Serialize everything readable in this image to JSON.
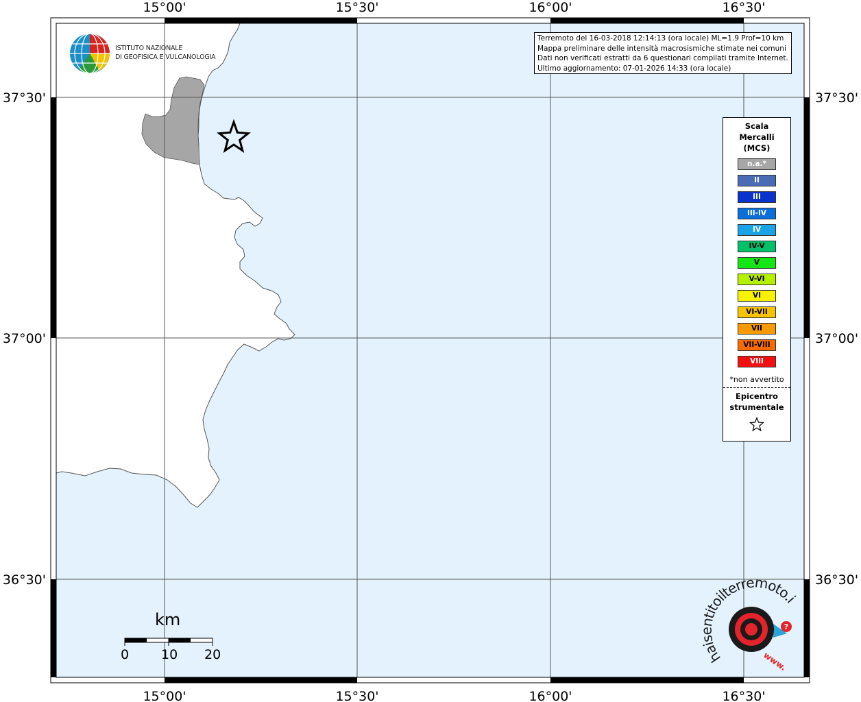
{
  "map": {
    "axis_labels": {
      "top": [
        "15°00'",
        "15°30'",
        "16°00'",
        "16°30'"
      ],
      "bottom": [
        "15°00'",
        "15°30'",
        "16°00'",
        "16°30'"
      ],
      "left": [
        "37°30'",
        "37°00'",
        "36°30'"
      ],
      "right": [
        "37°30'",
        "37°00'",
        "36°30'"
      ]
    },
    "sea_color": "#e3f2fc",
    "land_color": "#ffffff",
    "affected_color": "#a6a6a6"
  },
  "info": {
    "line1": "Terremoto del 16-03-2018 12:14:13 (ora locale) ML=1.9 Prof=10 km",
    "line2": "Mappa preliminare delle intensità macrosismiche stimate nei comuni",
    "line3": "Dati non verificati estratti da 6 questionari compilati tramite Internet.",
    "line4": "Ultimo aggiornamento: 07-01-2026 14:33 (ora locale)"
  },
  "legend": {
    "title_line1": "Scala",
    "title_line2": "Mercalli",
    "title_line3": "(MCS)",
    "items": [
      {
        "label": "n.a.*",
        "color": "#a6a6a6",
        "text": "#ffffff"
      },
      {
        "label": "II",
        "color": "#4a6bb5",
        "text": "#ffffff"
      },
      {
        "label": "III",
        "color": "#0a33cc",
        "text": "#ffffff"
      },
      {
        "label": "III-IV",
        "color": "#0a6fd8",
        "text": "#ffffff"
      },
      {
        "label": "IV",
        "color": "#1aa3e6",
        "text": "#ffffff"
      },
      {
        "label": "IV-V",
        "color": "#00c06a",
        "text": "#000000"
      },
      {
        "label": "V",
        "color": "#14e614",
        "text": "#000000"
      },
      {
        "label": "V-VI",
        "color": "#b4f000",
        "text": "#000000"
      },
      {
        "label": "VI",
        "color": "#f7f200",
        "text": "#000000"
      },
      {
        "label": "VI-VII",
        "color": "#f7c200",
        "text": "#000000"
      },
      {
        "label": "VII",
        "color": "#f79a00",
        "text": "#000000"
      },
      {
        "label": "VII-VIII",
        "color": "#f76a00",
        "text": "#000000"
      },
      {
        "label": "VIII",
        "color": "#f01010",
        "text": "#ffffff"
      }
    ],
    "note": "*non avvertito",
    "epicentre_line1": "Epicentro",
    "epicentre_line2": "strumentale"
  },
  "logos": {
    "ingv_line1": "ISTITUTO NAZIONALE",
    "ingv_line2": "DI GEOFISICA E VULCANOLOGIA",
    "hsit_text": "haisentitoilterremoto.it",
    "hsit_www": "www."
  },
  "scale_bar": {
    "unit": "km",
    "labels": [
      "0",
      "10",
      "20"
    ]
  }
}
